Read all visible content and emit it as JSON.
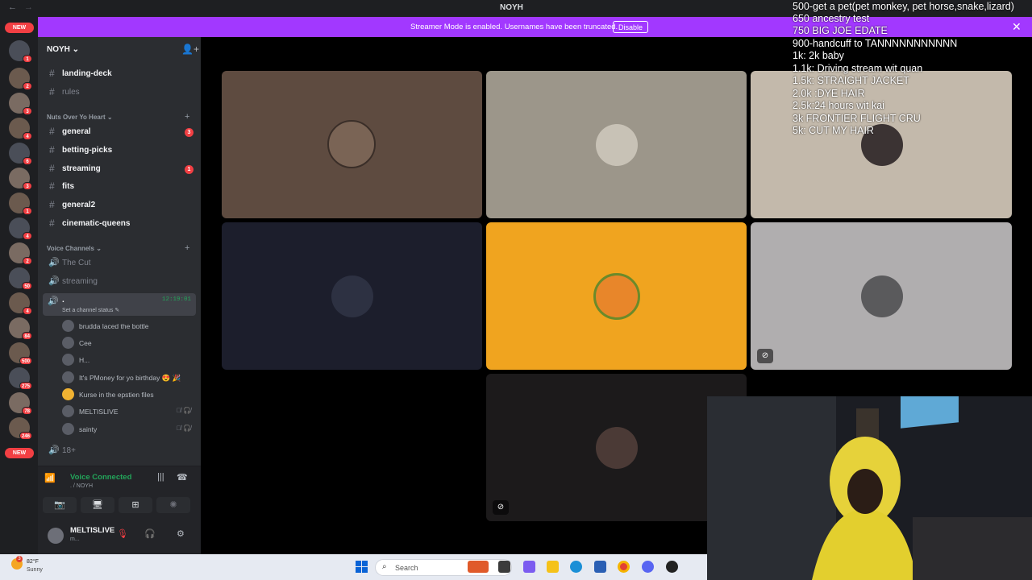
{
  "titlebar": {
    "title": "NOYH",
    "back": "←",
    "forward": "→"
  },
  "banner": {
    "message": "Streamer Mode is enabled. Usernames have been truncated.",
    "disable_label": "Disable",
    "close": "✕"
  },
  "servers": {
    "new_label": "NEW",
    "badges": [
      "1",
      "2",
      "3",
      "4",
      "6",
      "3",
      "1",
      "4",
      "2",
      "2",
      "50",
      "4",
      "84",
      "500",
      "275",
      "78",
      "246"
    ]
  },
  "server": {
    "name": "NOYH ⌄",
    "invite_icon": "👤+"
  },
  "channels": {
    "top": [
      {
        "name": "landing-deck",
        "bold": true
      },
      {
        "name": "rules",
        "bold": false
      }
    ],
    "category1": "Nuts Over Yo Heart ⌄",
    "list": [
      {
        "name": "general",
        "bold": true,
        "badge": "3"
      },
      {
        "name": "betting-picks",
        "bold": true,
        "badge": ""
      },
      {
        "name": "streaming",
        "bold": true,
        "badge": "1"
      },
      {
        "name": "fits",
        "bold": true,
        "badge": ""
      },
      {
        "name": "general2",
        "bold": true,
        "badge": ""
      },
      {
        "name": "cinematic-queens",
        "bold": true,
        "badge": ""
      }
    ],
    "voice_category": "Voice Channels ⌄",
    "voice": [
      "The Cut",
      "streaming"
    ],
    "active": {
      "name": ".",
      "timer": "12:19:01",
      "status": "Set a channel status ✎"
    },
    "members": [
      {
        "name": "brudda laced the bottle",
        "muted": false
      },
      {
        "name": "Cee",
        "muted": false
      },
      {
        "name": "H...",
        "muted": false
      },
      {
        "name": "It's PMoney for yo birthday 😍 🎉",
        "muted": false
      },
      {
        "name": "Kurse in the epstien files",
        "muted": false
      },
      {
        "name": "MELTISLIVE",
        "muted": true
      },
      {
        "name": "sainty",
        "muted": true
      }
    ],
    "after": "18+"
  },
  "voice_panel": {
    "status": "Voice Connected",
    "sub": ". / NOYH"
  },
  "user": {
    "name": "MELTISLIVE",
    "sub": "m..."
  },
  "overlay_lines": [
    "500-get a pet(pet monkey, pet horse,snake,lizard)",
    "650 ancestry test",
    "750 BIG JOE EDATE",
    "900-handcuff to TANNNNNNNNNNN",
    "1k: 2k baby",
    "1.1k: Driving stream wit quan",
    "1.5k: STRAIGHT JACKET",
    "2.0k :DYE HAIR",
    "2.5k:24 hours wit kai",
    "3k FRONTIER FLIGHT CRU",
    "5k: CUT MY HAIR"
  ],
  "taskbar": {
    "temp": "82°F",
    "condition": "Sunny",
    "search_placeholder": "Search",
    "weather_badge": "3"
  },
  "colors": {
    "accent": "#a238ff",
    "green": "#23a55a",
    "red": "#f23f43",
    "orange_tile": "#f0a41f"
  }
}
